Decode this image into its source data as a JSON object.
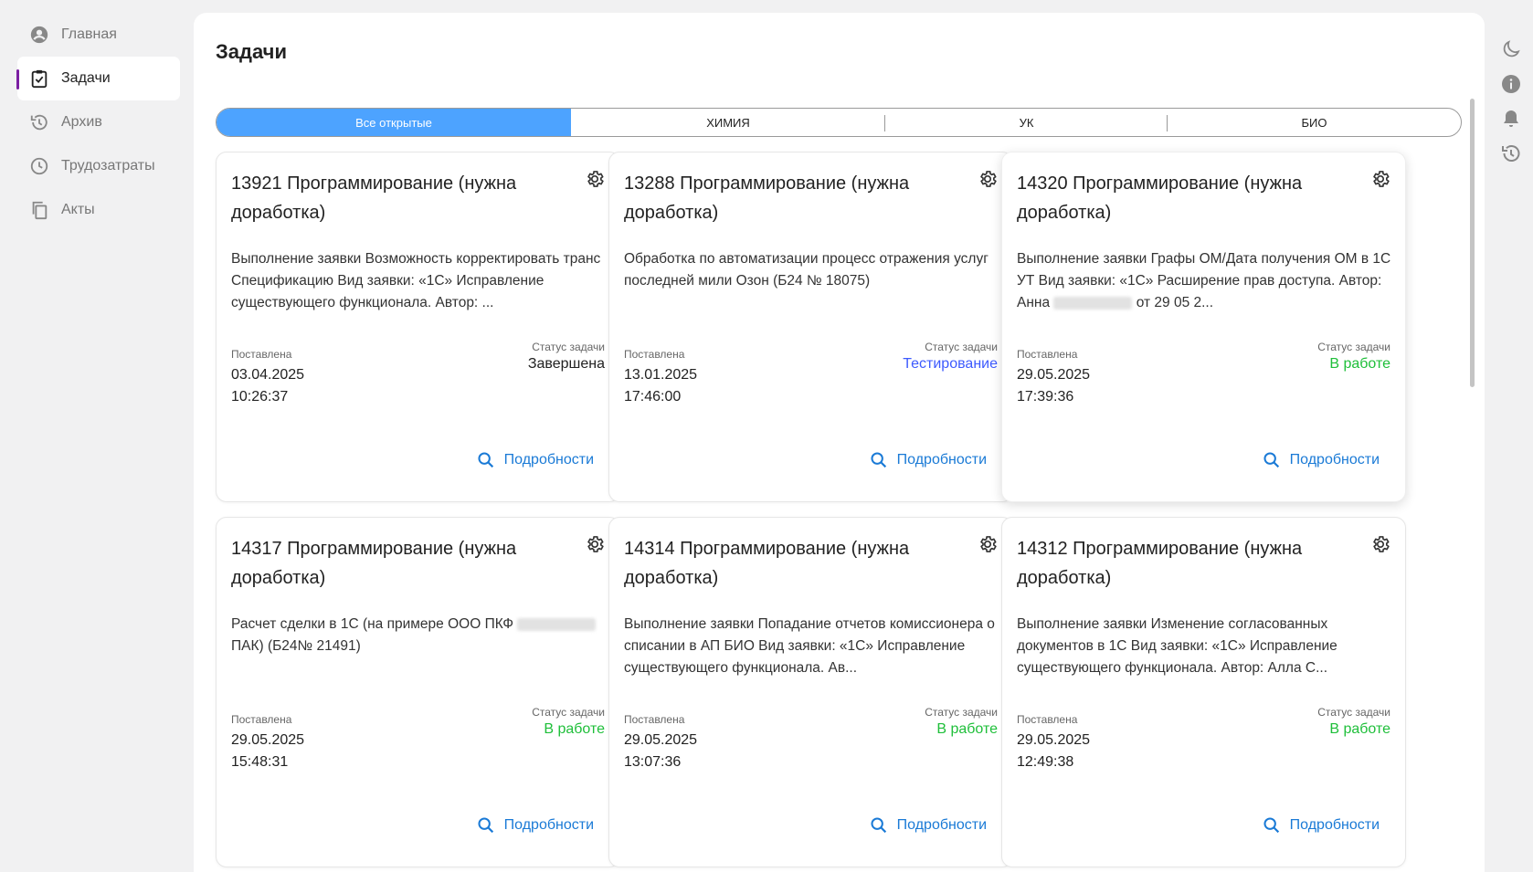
{
  "sidebar": {
    "items": [
      {
        "label": "Главная",
        "icon": "account-circle-icon",
        "active": false
      },
      {
        "label": "Задачи",
        "icon": "clipboard-check-icon",
        "active": true
      },
      {
        "label": "Архив",
        "icon": "history-icon",
        "active": false
      },
      {
        "label": "Трудозатраты",
        "icon": "clock-icon",
        "active": false
      },
      {
        "label": "Акты",
        "icon": "copy-icon",
        "active": false
      }
    ]
  },
  "page": {
    "title": "Задачи"
  },
  "tabs": [
    {
      "label": "Все открытые",
      "active": true
    },
    {
      "label": "ХИМИЯ",
      "active": false
    },
    {
      "label": "УК",
      "active": false
    },
    {
      "label": "БИО",
      "active": false
    }
  ],
  "labels": {
    "placed": "Поставлена",
    "status": "Статус задачи",
    "details": "Подробности"
  },
  "colors": {
    "accent": "#4da3ff",
    "active_marker": "#7b1fa2",
    "link": "#1a7ad6",
    "status_done": "#222222",
    "status_testing": "#3d5afe",
    "status_in_work": "#1fbf3a"
  },
  "cards": [
    {
      "title": "13921 Программирование (нужна доработка)",
      "description": "Выполнение заявки Возможность корректировать транс Спецификацию Вид заявки: «1С» Исправление существующего функционала. Автор: ...",
      "date": "03.04.2025",
      "time": "10:26:37",
      "status": "Завершена",
      "status_color": "#222222"
    },
    {
      "title": "13288 Программирование (нужна доработка)",
      "description": "Обработка по автоматизации процесс отражения услуг последней мили Озон (Б24 № 18075)",
      "date": "13.01.2025",
      "time": "17:46:00",
      "status": "Тестирование",
      "status_color": "#3d5afe"
    },
    {
      "title": "14320 Программирование (нужна доработка)",
      "description_parts": [
        "Выполнение заявки Графы ОМ/Дата получения ОМ в 1С УТ Вид заявки: «1С» Расширение прав доступа. Автор: Анна",
        "от 29 05 2..."
      ],
      "date": "29.05.2025",
      "time": "17:39:36",
      "status": "В работе",
      "status_color": "#1fbf3a"
    },
    {
      "title": "14317 Программирование (нужна доработка)",
      "description_parts": [
        "Расчет сделки в 1С (на примере ООО ПКФ",
        "ПАК) (Б24№ 21491)"
      ],
      "date": "29.05.2025",
      "time": "15:48:31",
      "status": "В работе",
      "status_color": "#1fbf3a"
    },
    {
      "title": "14314 Программирование (нужна доработка)",
      "description": "Выполнение заявки Попадание отчетов комиссионера о списании в АП БИО Вид заявки: «1С» Исправление существующего функционала. Ав...",
      "date": "29.05.2025",
      "time": "13:07:36",
      "status": "В работе",
      "status_color": "#1fbf3a"
    },
    {
      "title": "14312 Программирование (нужна доработка)",
      "description": "Выполнение заявки Изменение согласованных документов в 1С Вид заявки: «1С» Исправление существующего функционала. Автор: Алла С...",
      "date": "29.05.2025",
      "time": "12:49:38",
      "status": "В работе",
      "status_color": "#1fbf3a"
    }
  ],
  "right_rail": [
    "moon-icon",
    "info-icon",
    "bell-icon",
    "history-icon"
  ]
}
